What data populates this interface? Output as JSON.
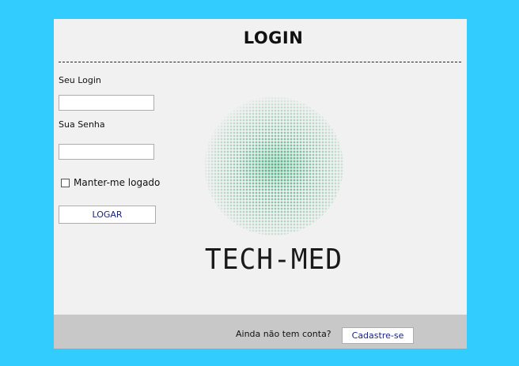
{
  "login": {
    "title": "LOGIN",
    "username_label": "Seu Login",
    "username_value": "",
    "password_label": "Sua Senha",
    "password_value": "",
    "remember_label": "Manter-me logado",
    "remember_checked": false,
    "submit_label": "LOGAR"
  },
  "brand": {
    "name": "TECH-MED",
    "graphic_icon": "halftone-circle-logo",
    "accent_color": "#40a878"
  },
  "footer": {
    "prompt": "Ainda não tem conta?",
    "signup_label": "Cadastre-se"
  },
  "colors": {
    "background": "#33ccff",
    "panel": "#f1f1f1",
    "footer": "#c8c8c8",
    "button_text": "#1a237e"
  }
}
